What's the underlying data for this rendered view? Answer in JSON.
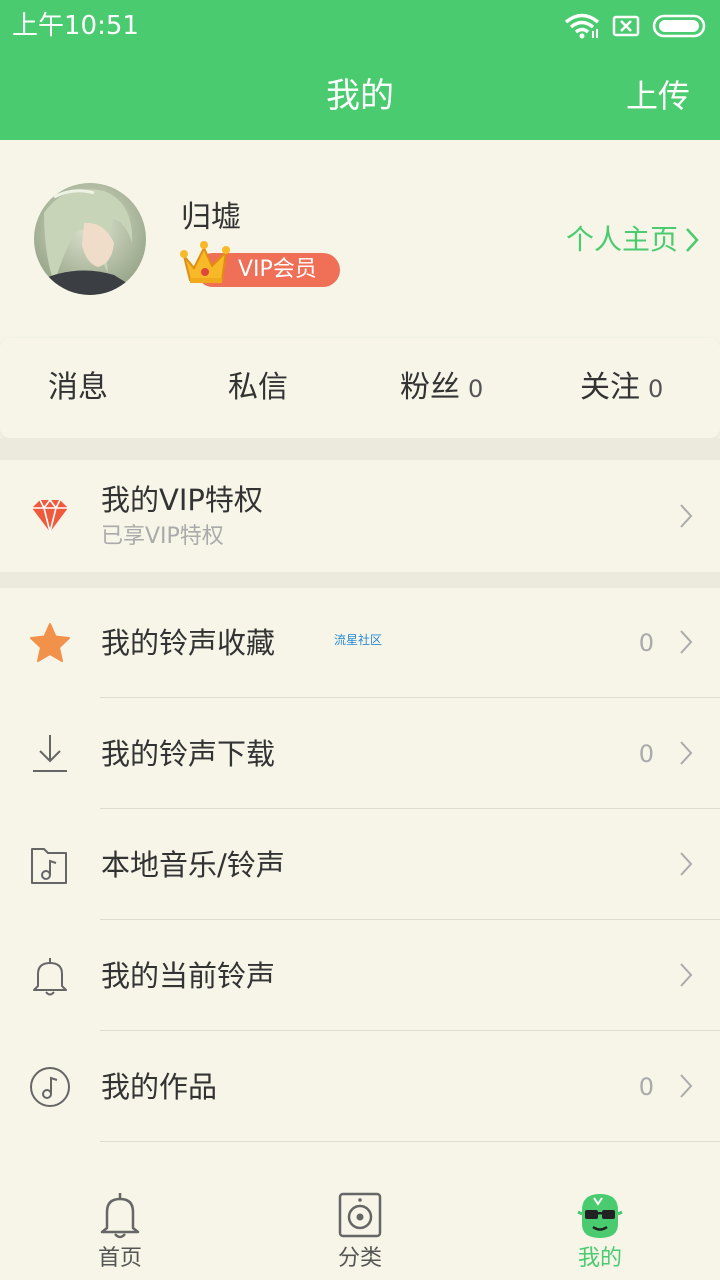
{
  "status_bar": {
    "time": "上午10:51"
  },
  "header": {
    "title": "我的",
    "upload_label": "上传"
  },
  "profile": {
    "username": "归墟",
    "vip_badge": "VIP会员",
    "homepage_link": "个人主页"
  },
  "stats": [
    {
      "label": "消息",
      "count": ""
    },
    {
      "label": "私信",
      "count": ""
    },
    {
      "label": "粉丝",
      "count": "0"
    },
    {
      "label": "关注",
      "count": "0"
    }
  ],
  "vip_section": {
    "title": "我的VIP特权",
    "subtitle": "已享VIP特权"
  },
  "menu": [
    {
      "label": "我的铃声收藏",
      "count": "0",
      "icon": "star-icon"
    },
    {
      "label": "我的铃声下载",
      "count": "0",
      "icon": "download-icon"
    },
    {
      "label": "本地音乐/铃声",
      "count": "",
      "icon": "music-folder-icon"
    },
    {
      "label": "我的当前铃声",
      "count": "",
      "icon": "bell-icon"
    },
    {
      "label": "我的作品",
      "count": "0",
      "icon": "music-note-icon"
    }
  ],
  "watermark": "流星社区",
  "tabs": [
    {
      "label": "首页",
      "icon": "bell-icon"
    },
    {
      "label": "分类",
      "icon": "speaker-icon"
    },
    {
      "label": "我的",
      "icon": "mascot-icon"
    }
  ],
  "colors": {
    "brand": "#4bcb6f",
    "vip": "#ef6f57",
    "background": "#f6f5e8",
    "star": "#f2914a"
  }
}
